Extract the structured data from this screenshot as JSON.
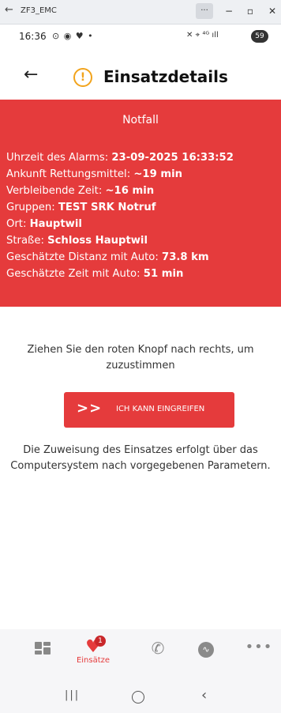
{
  "window": {
    "title": "ZF3_EMC",
    "back_icon": "arrow-left-icon",
    "more_label": "···",
    "min_label": "−",
    "max_label": "▫",
    "close_label": "✕"
  },
  "status_bar": {
    "time": "16:36",
    "left_icons": "⊙ ◉ ♥ •",
    "right_icons": "✕ ⌖ ⁴ᴳ ıll",
    "battery": "59"
  },
  "header": {
    "title": "Einsatzdetails",
    "warning_icon": "warning-circle-icon",
    "warning_glyph": "!"
  },
  "card": {
    "heading": "Notfall",
    "color": "#e53b3c",
    "rows": [
      {
        "label": "Uhrzeit des Alarms: ",
        "value": "23-09-2025 16:33:52"
      },
      {
        "label": "Ankunft Rettungsmittel: ",
        "value": "~19 min"
      },
      {
        "label": "Verbleibende Zeit: ",
        "value": "~16 min"
      },
      {
        "label": "Gruppen: ",
        "value": "TEST SRK Notruf"
      },
      {
        "label": "Ort: ",
        "value": "Hauptwil"
      },
      {
        "label": "Straße: ",
        "value": "Schloss Hauptwil"
      },
      {
        "label": "Geschätzte Distanz mit Auto: ",
        "value": "73.8 km"
      },
      {
        "label": "Geschätzte Zeit mit Auto: ",
        "value": "51 min"
      }
    ]
  },
  "instruction": "Ziehen Sie den roten Knopf nach rechts, um zuzustimmen",
  "slider": {
    "knob": ">>",
    "label": "ICH KANN EINGREIFEN"
  },
  "note": "Die Zuweisung des Einsatzes erfolgt über das Computersystem nach vorgegebenen Parametern.",
  "bottom_nav": {
    "active_label": "Einsätze",
    "badge": "1",
    "heart_glyph": "♥",
    "phone_glyph": "✆",
    "pulse_glyph": "∿",
    "more_glyph": "•••"
  },
  "system_nav": {
    "recent": "|||",
    "back": "‹"
  }
}
